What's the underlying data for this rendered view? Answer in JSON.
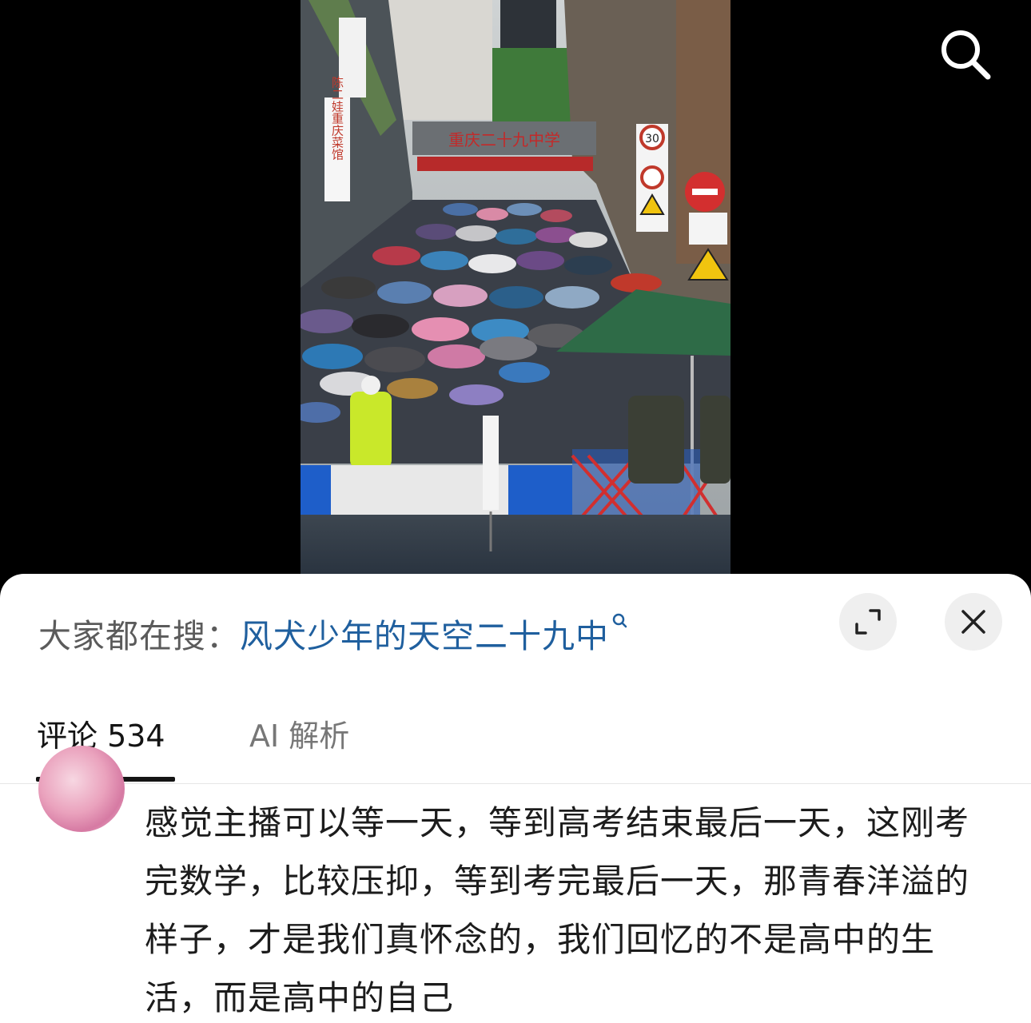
{
  "app": {
    "colors": {
      "link": "#1f5f9e",
      "text_primary": "#1c1c1c",
      "text_secondary": "#5b5b5b",
      "sheet_bg": "#ffffff",
      "button_bg": "#efefef"
    }
  },
  "media": {
    "search_icon": "search-icon",
    "photo_signs": {
      "banner": "重庆二十九中学",
      "left_sign": "陈二娃重庆菜馆",
      "speed_limit": "30"
    }
  },
  "sheet": {
    "search_prefix": "大家都在搜：",
    "search_term": "风犬少年的天空二十九中",
    "expand_icon": "expand-icon",
    "close_icon": "close-icon",
    "tabs": [
      {
        "label": "评论 534",
        "active": true
      },
      {
        "label": "AI 解析",
        "active": false
      }
    ]
  },
  "comments": [
    {
      "text": "感觉主播可以等一天，等到高考结束最后一天，这刚考完数学，比较压抑，等到考完最后一天，那青春洋溢的样子，才是我们真怀念的，我们回忆的不是高中的生活，而是高中的自己"
    }
  ]
}
